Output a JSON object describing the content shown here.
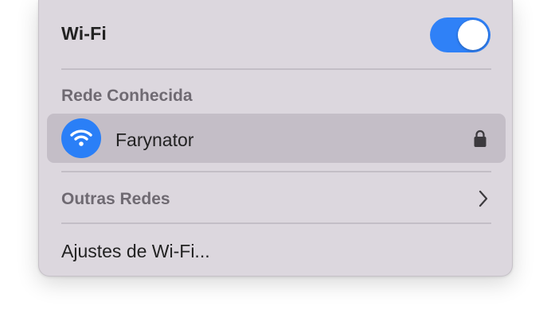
{
  "wifi": {
    "title": "Wi-Fi",
    "enabled": true,
    "accent_color": "#2f81f7"
  },
  "known_network": {
    "header": "Rede Conhecida",
    "name": "Farynator",
    "icon": "wifi-icon",
    "secured_icon": "lock-icon"
  },
  "other_networks": {
    "label": "Outras Redes",
    "icon": "chevron-right-icon"
  },
  "settings": {
    "label": "Ajustes de Wi-Fi..."
  }
}
